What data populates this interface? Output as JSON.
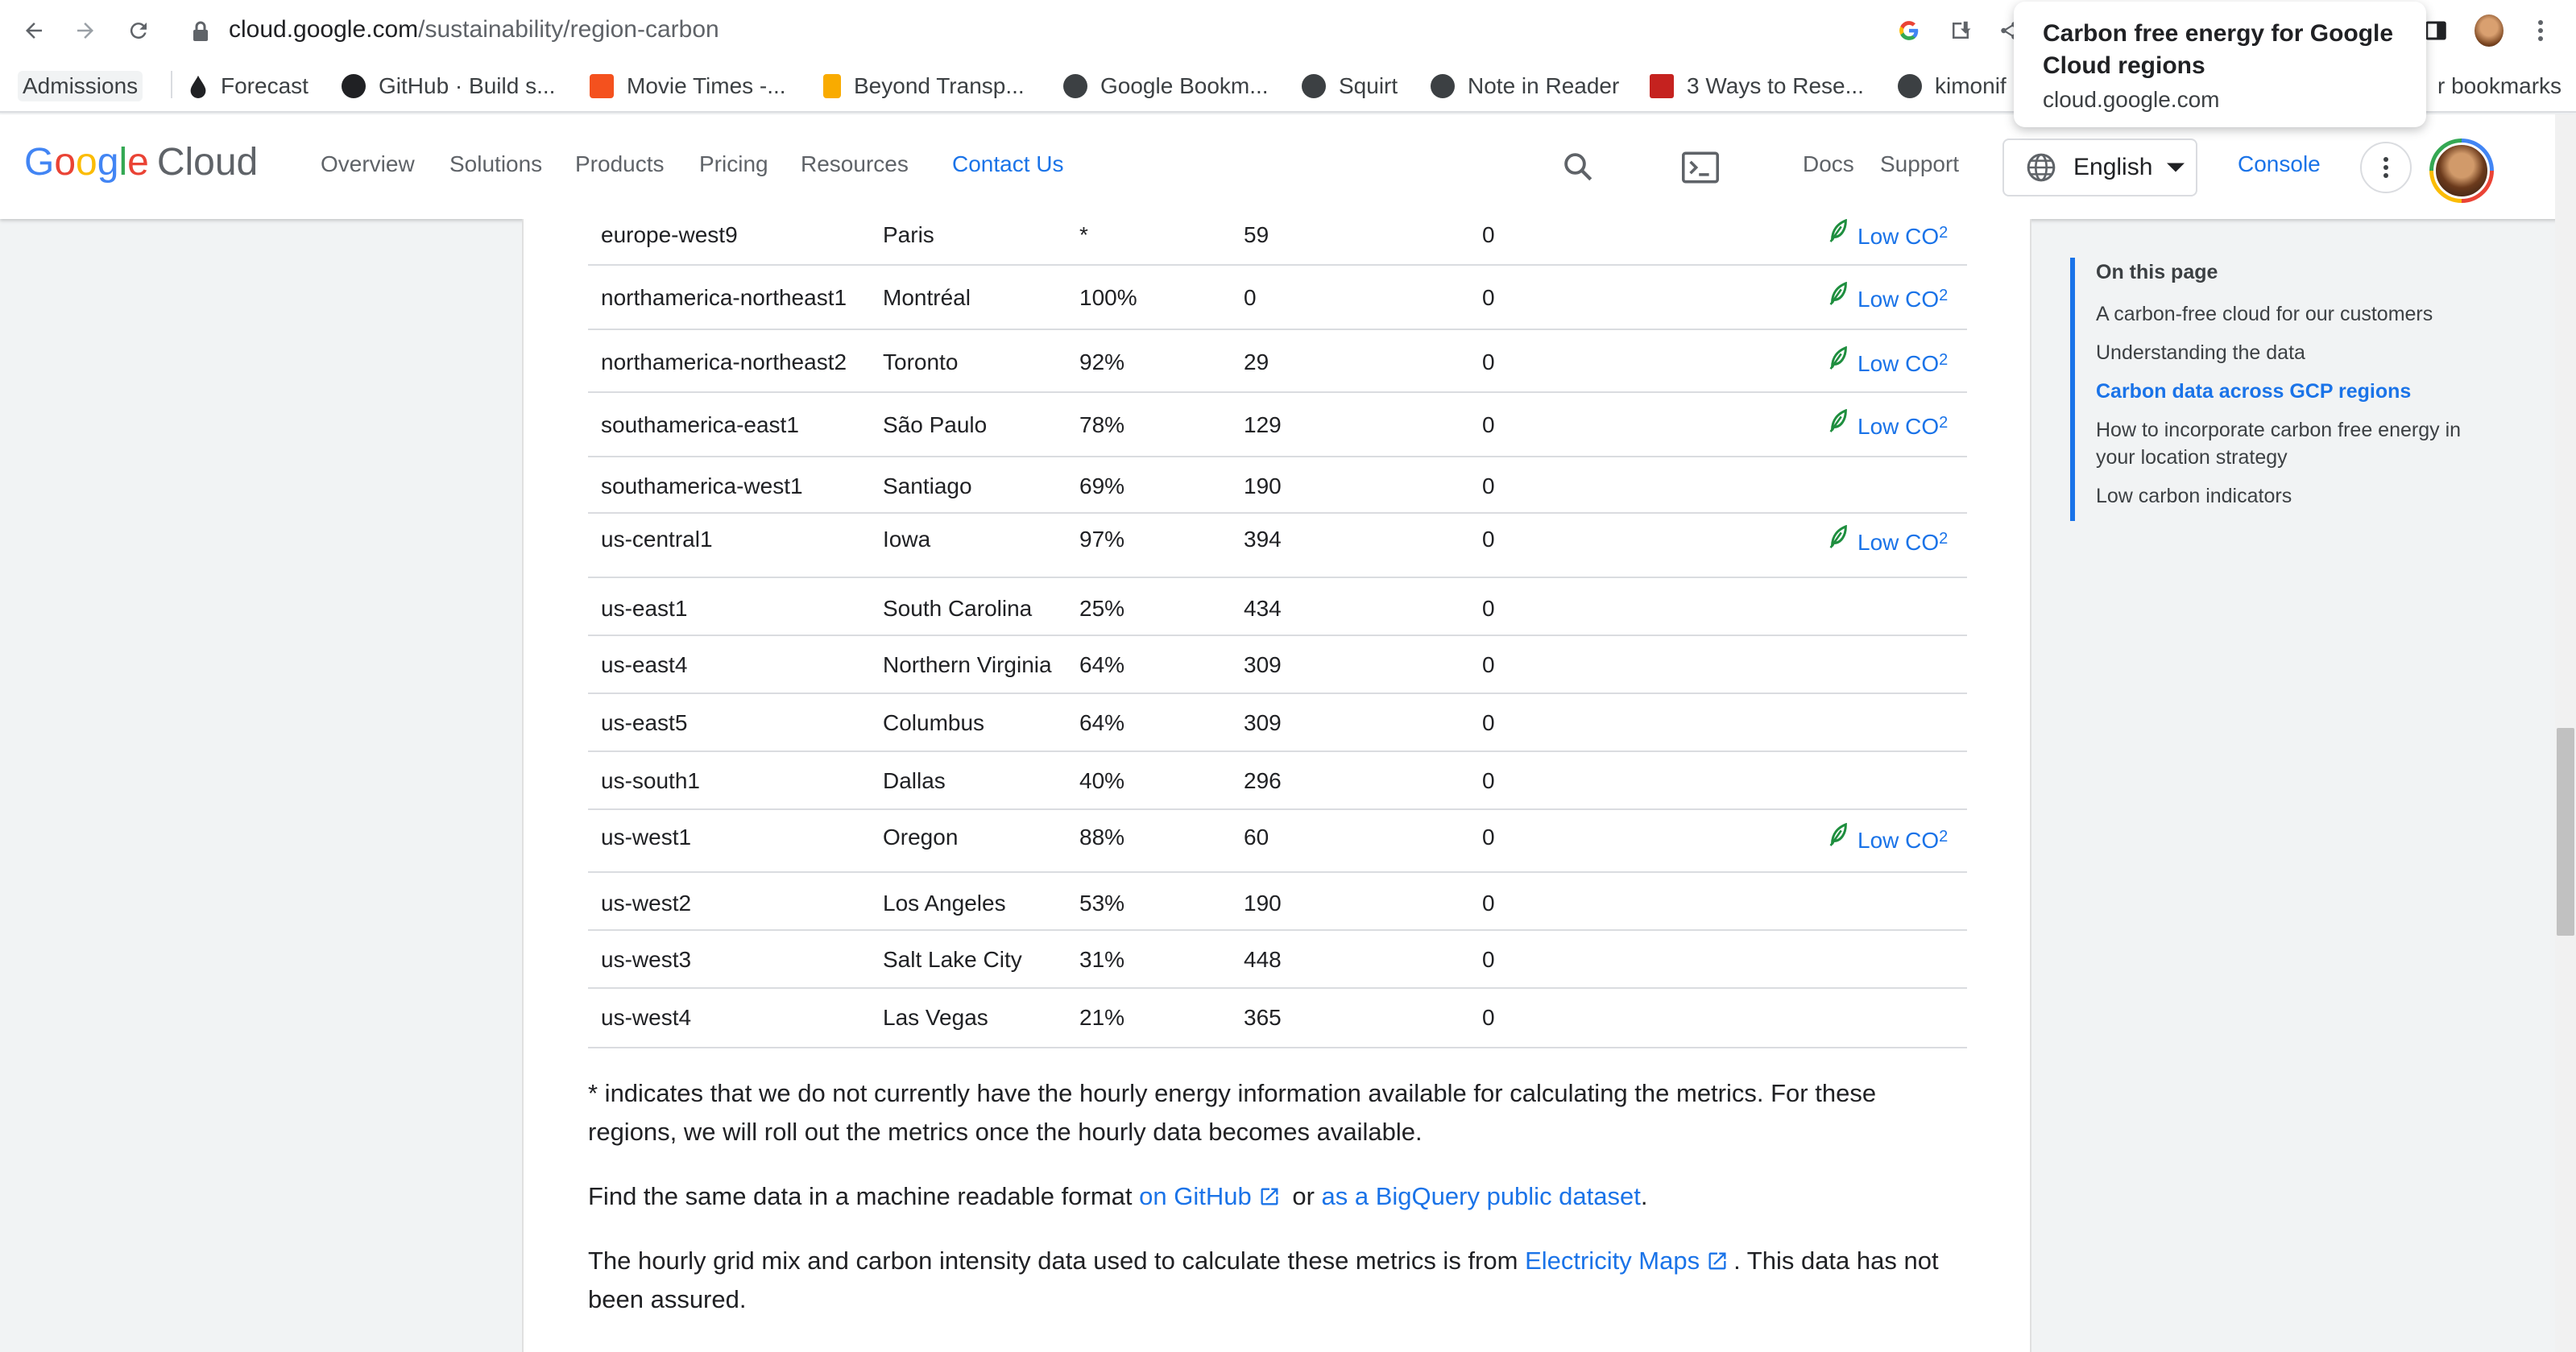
{
  "browser": {
    "url_domain": "cloud.google.com",
    "url_path": "/sustainability/region-carbon",
    "bookmarks": [
      {
        "label": "Admissions"
      },
      {
        "label": "Forecast"
      },
      {
        "label": "GitHub · Build s..."
      },
      {
        "label": "Movie Times -..."
      },
      {
        "label": "Beyond Transp..."
      },
      {
        "label": "Google Bookm..."
      },
      {
        "label": "Squirt"
      },
      {
        "label": "Note in Reader"
      },
      {
        "label": "3 Ways to Rese..."
      },
      {
        "label": "kimonif"
      },
      {
        "label": "r bookmarks"
      }
    ],
    "tooltip": {
      "title": "Carbon free energy for Google Cloud regions",
      "domain": "cloud.google.com"
    }
  },
  "site": {
    "logo_google": "Google",
    "logo_cloud": "Cloud",
    "nav": [
      "Overview",
      "Solutions",
      "Products",
      "Pricing",
      "Resources",
      "Contact Us"
    ],
    "docs": "Docs",
    "support": "Support",
    "language": "English",
    "console": "Console"
  },
  "table": {
    "low_label": "Low CO",
    "low_sub": "2",
    "rows": [
      {
        "region": "europe-west9",
        "location": "Paris",
        "cfe": "*",
        "intensity": "59",
        "net": "0",
        "low": true
      },
      {
        "region": "northamerica-northeast1",
        "location": "Montréal",
        "cfe": "100%",
        "intensity": "0",
        "net": "0",
        "low": true
      },
      {
        "region": "northamerica-northeast2",
        "location": "Toronto",
        "cfe": "92%",
        "intensity": "29",
        "net": "0",
        "low": true
      },
      {
        "region": "southamerica-east1",
        "location": "São Paulo",
        "cfe": "78%",
        "intensity": "129",
        "net": "0",
        "low": true
      },
      {
        "region": "southamerica-west1",
        "location": "Santiago",
        "cfe": "69%",
        "intensity": "190",
        "net": "0",
        "low": false
      },
      {
        "region": "us-central1",
        "location": "Iowa",
        "cfe": "97%",
        "intensity": "394",
        "net": "0",
        "low": true
      },
      {
        "region": "us-east1",
        "location": "South Carolina",
        "cfe": "25%",
        "intensity": "434",
        "net": "0",
        "low": false
      },
      {
        "region": "us-east4",
        "location": "Northern Virginia",
        "cfe": "64%",
        "intensity": "309",
        "net": "0",
        "low": false
      },
      {
        "region": "us-east5",
        "location": "Columbus",
        "cfe": "64%",
        "intensity": "309",
        "net": "0",
        "low": false
      },
      {
        "region": "us-south1",
        "location": "Dallas",
        "cfe": "40%",
        "intensity": "296",
        "net": "0",
        "low": false
      },
      {
        "region": "us-west1",
        "location": "Oregon",
        "cfe": "88%",
        "intensity": "60",
        "net": "0",
        "low": true
      },
      {
        "region": "us-west2",
        "location": "Los Angeles",
        "cfe": "53%",
        "intensity": "190",
        "net": "0",
        "low": false
      },
      {
        "region": "us-west3",
        "location": "Salt Lake City",
        "cfe": "31%",
        "intensity": "448",
        "net": "0",
        "low": false
      },
      {
        "region": "us-west4",
        "location": "Las Vegas",
        "cfe": "21%",
        "intensity": "365",
        "net": "0",
        "low": false
      }
    ]
  },
  "content": {
    "note": "* indicates that we do not currently have the hourly energy information available for calculating the metrics. For these regions, we will roll out the metrics once the hourly data becomes available.",
    "find_prefix": "Find the same data in a machine readable format",
    "find_github": "on GitHub",
    "find_or": "or",
    "find_bq": "as a BigQuery public dataset",
    "find_end": ".",
    "hourly_prefix": "The hourly grid mix and carbon intensity data used to calculate these metrics is from",
    "hourly_link": "Electricity Maps",
    "hourly_suffix": ". This data has not been assured."
  },
  "toc": {
    "title": "On this page",
    "items": [
      "A carbon-free cloud for our customers",
      "Understanding the data",
      "Carbon data across GCP regions",
      "How to incorporate carbon free energy in your location strategy",
      "Low carbon indicators"
    ],
    "active_index": 2
  },
  "colors": {
    "link": "#1a73e8",
    "leaf": "#1e8e3e",
    "divider": "#dadce0"
  }
}
